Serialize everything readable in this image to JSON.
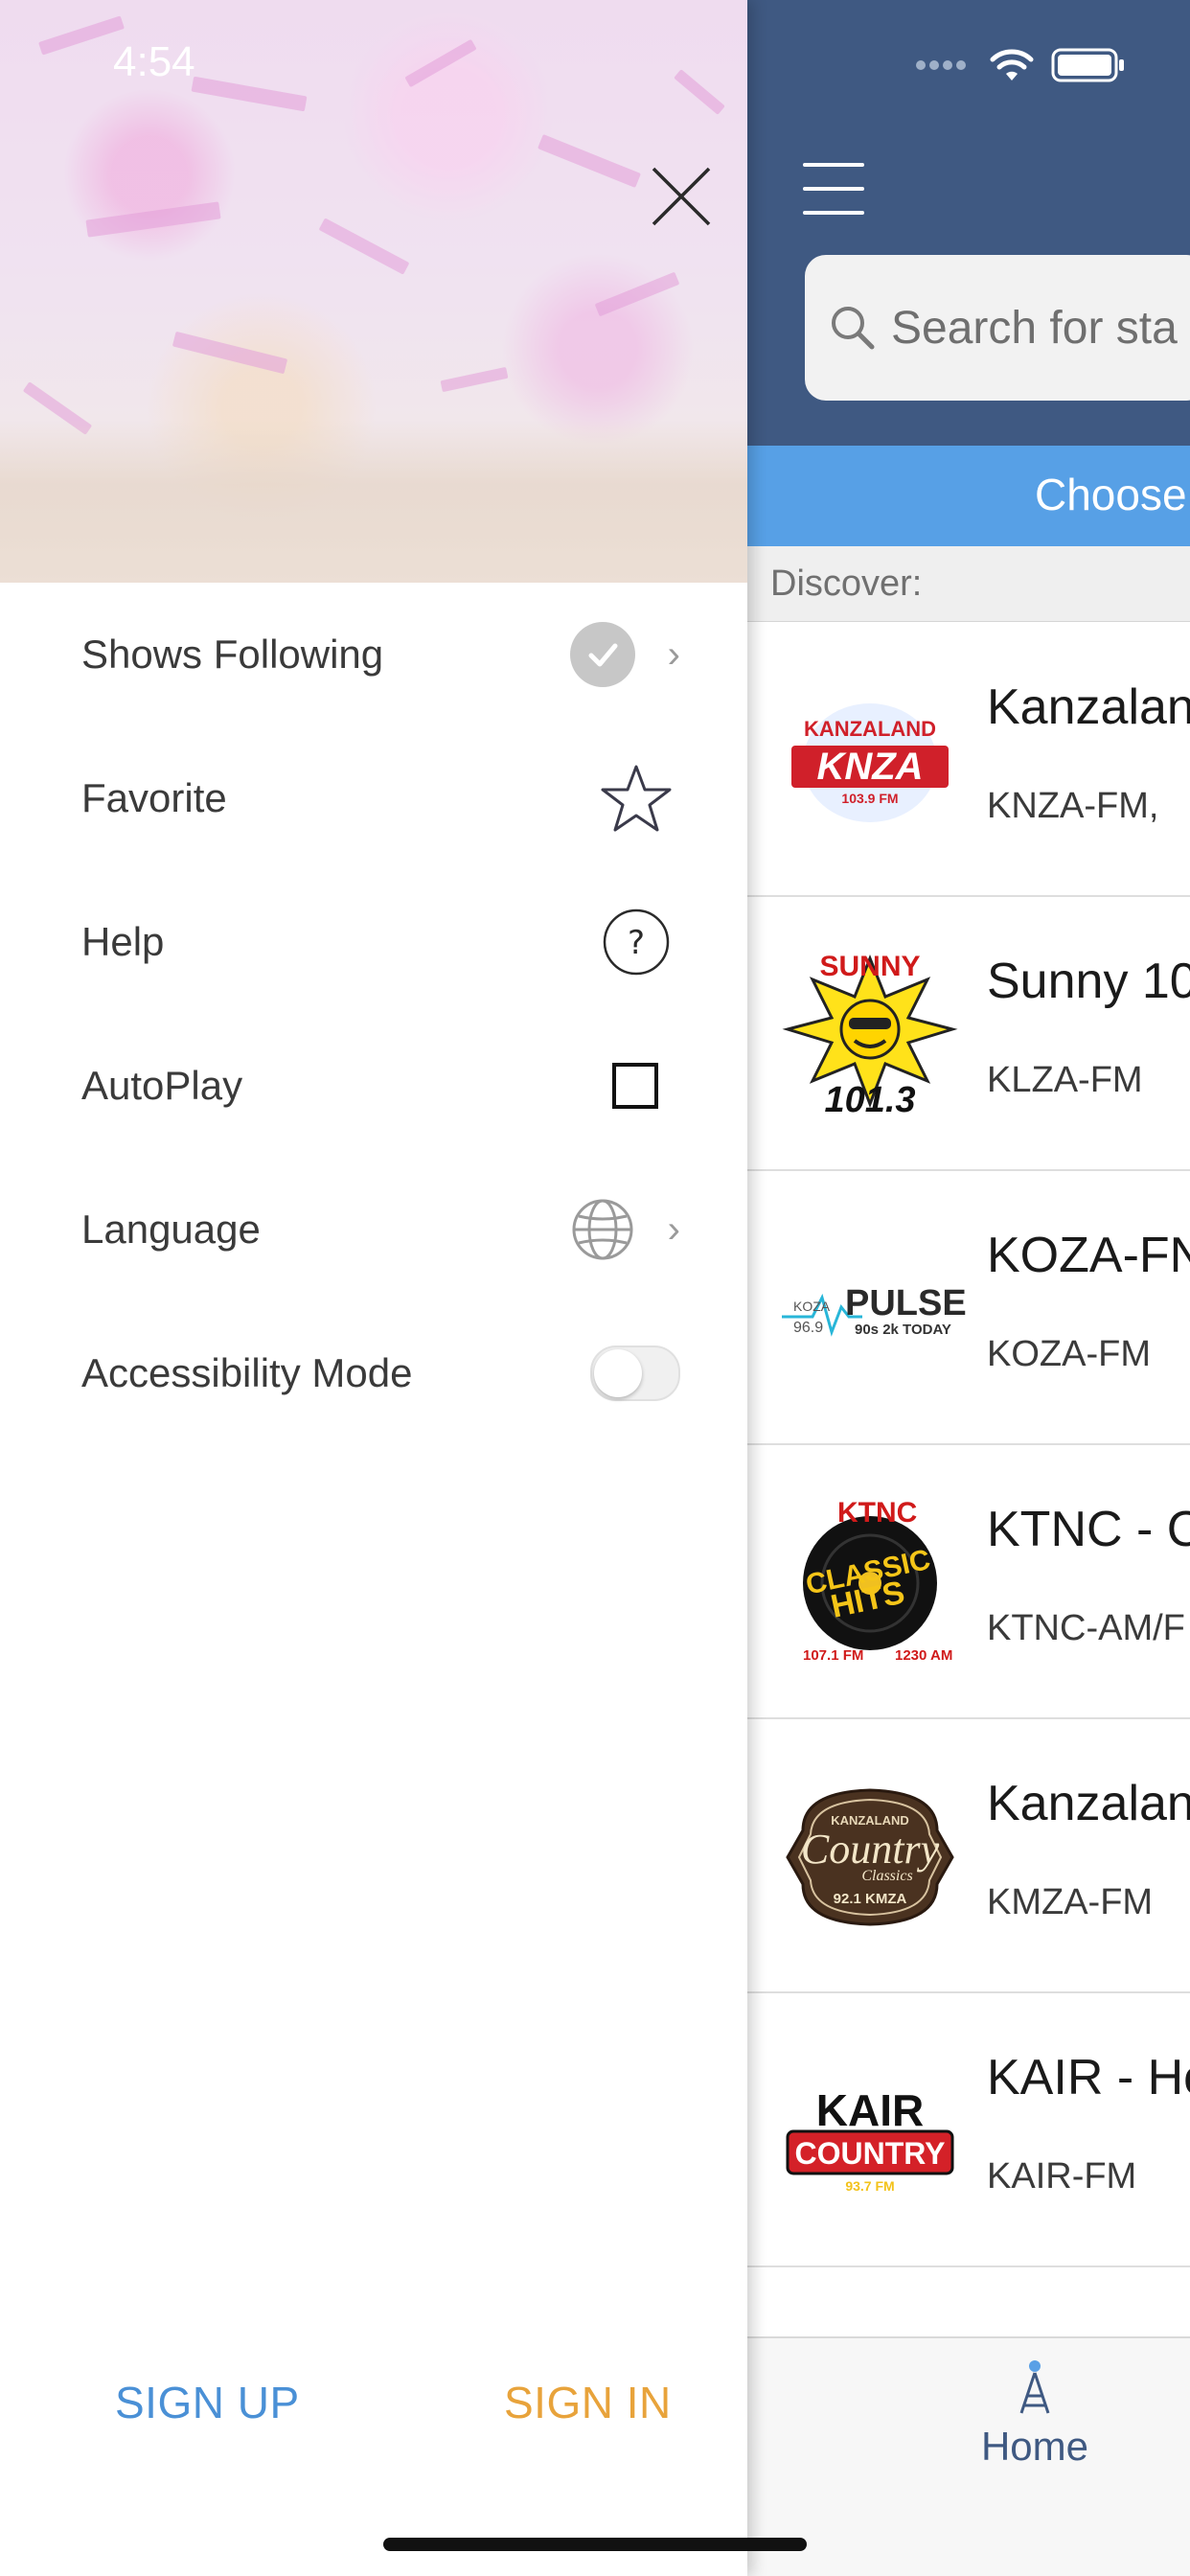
{
  "status_bar": {
    "time": "4:54",
    "icons": [
      "signal-dots-icon",
      "wifi-icon",
      "battery-icon"
    ]
  },
  "drawer": {
    "close_icon": "close-icon",
    "menu_items": [
      {
        "label": "Shows Following",
        "icon": "check-circle-icon",
        "chevron": true
      },
      {
        "label": "Favorite",
        "icon": "star-icon",
        "chevron": false
      },
      {
        "label": "Help",
        "icon": "question-circle-icon",
        "chevron": false
      },
      {
        "label": "AutoPlay",
        "icon": "checkbox-icon",
        "chevron": false
      },
      {
        "label": "Language",
        "icon": "globe-icon",
        "chevron": true
      },
      {
        "label": "Accessibility Mode",
        "icon": "toggle-switch",
        "chevron": false,
        "toggle_on": false
      }
    ],
    "footer": {
      "sign_up": "SIGN UP",
      "sign_in": "SIGN IN"
    },
    "colors": {
      "sign_up": "#4a90d6",
      "sign_in": "#e8a33b"
    }
  },
  "main": {
    "search_placeholder": "Search for sta",
    "choose_label": "Choose",
    "discover_label": "Discover:",
    "stations": [
      {
        "name": "Kanzalan",
        "call": "KNZA-FM,",
        "logo": "kanzaland-knza-logo"
      },
      {
        "name": "Sunny 10",
        "call": "KLZA-FM",
        "logo": "sunny-1013-logo"
      },
      {
        "name": "KOZA-FN",
        "call": "KOZA-FM",
        "logo": "pulse-969-logo"
      },
      {
        "name": "KTNC - C",
        "call": "KTNC-AM/F",
        "logo": "ktnc-classic-hits-logo"
      },
      {
        "name": "Kanzalan",
        "call": "KMZA-FM",
        "logo": "kanzaland-country-classics-logo"
      },
      {
        "name": "KAIR - Ho",
        "call": "KAIR-FM",
        "logo": "kair-country-logo"
      }
    ],
    "tabbar": {
      "home_label": "Home",
      "home_icon": "radio-tower-icon"
    },
    "colors": {
      "topbar": "#3f5982",
      "choose_bar": "#57a0e6"
    }
  }
}
